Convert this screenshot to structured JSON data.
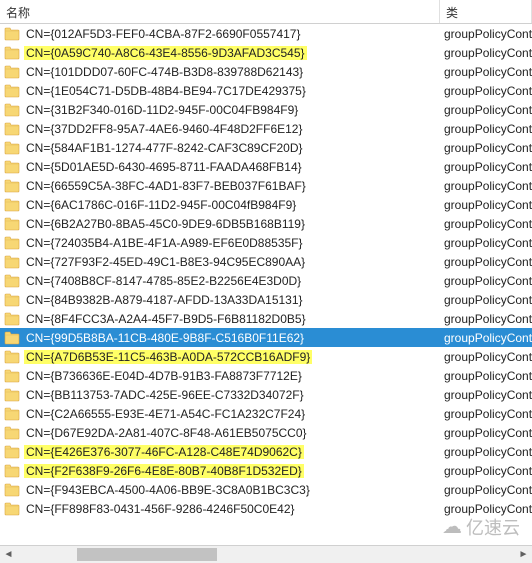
{
  "columns": {
    "name": "名称",
    "type": "类"
  },
  "type_label": "groupPolicyContaine",
  "rows": [
    {
      "name": "CN={012AF5D3-FEF0-4CBA-87F2-6690F0557417}",
      "hl": false,
      "sel": false
    },
    {
      "name": "CN={0A59C740-A8C6-43E4-8556-9D3AFAD3C545}",
      "hl": true,
      "sel": false
    },
    {
      "name": "CN={101DDD07-60FC-474B-B3D8-839788D62143}",
      "hl": false,
      "sel": false
    },
    {
      "name": "CN={1E054C71-D5DB-48B4-BE94-7C17DE429375}",
      "hl": false,
      "sel": false
    },
    {
      "name": "CN={31B2F340-016D-11D2-945F-00C04FB984F9}",
      "hl": false,
      "sel": false
    },
    {
      "name": "CN={37DD2FF8-95A7-4AE6-9460-4F48D2FF6E12}",
      "hl": false,
      "sel": false
    },
    {
      "name": "CN={584AF1B1-1274-477F-8242-CAF3C89CF20D}",
      "hl": false,
      "sel": false
    },
    {
      "name": "CN={5D01AE5D-6430-4695-8711-FAADA468FB14}",
      "hl": false,
      "sel": false
    },
    {
      "name": "CN={66559C5A-38FC-4AD1-83F7-BEB037F61BAF}",
      "hl": false,
      "sel": false
    },
    {
      "name": "CN={6AC1786C-016F-11D2-945F-00C04fB984F9}",
      "hl": false,
      "sel": false
    },
    {
      "name": "CN={6B2A27B0-8BA5-45C0-9DE9-6DB5B168B119}",
      "hl": false,
      "sel": false
    },
    {
      "name": "CN={724035B4-A1BE-4F1A-A989-EF6E0D88535F}",
      "hl": false,
      "sel": false
    },
    {
      "name": "CN={727F93F2-45ED-49C1-B8E3-94C95EC890AA}",
      "hl": false,
      "sel": false
    },
    {
      "name": "CN={7408B8CF-8147-4785-85E2-B2256E4E3D0D}",
      "hl": false,
      "sel": false
    },
    {
      "name": "CN={84B9382B-A879-4187-AFDD-13A33DA15131}",
      "hl": false,
      "sel": false
    },
    {
      "name": "CN={8F4FCC3A-A2A4-45F7-B9D5-F6B81182D0B5}",
      "hl": false,
      "sel": false
    },
    {
      "name": "CN={99D5B8BA-11CB-480E-9B8F-C516B0F11E62}",
      "hl": true,
      "sel": true
    },
    {
      "name": "CN={A7D6B53E-11C5-463B-A0DA-572CCB16ADF9}",
      "hl": true,
      "sel": false
    },
    {
      "name": "CN={B736636E-E04D-4D7B-91B3-FA8873F7712E}",
      "hl": false,
      "sel": false
    },
    {
      "name": "CN={BB113753-7ADC-425E-96EE-C7332D34072F}",
      "hl": false,
      "sel": false
    },
    {
      "name": "CN={C2A66555-E93E-4E71-A54C-FC1A232C7F24}",
      "hl": false,
      "sel": false
    },
    {
      "name": "CN={D67E92DA-2A81-407C-8F48-A61EB5075CC0}",
      "hl": false,
      "sel": false
    },
    {
      "name": "CN={E426E376-3077-46FC-A128-C48E74D9062C}",
      "hl": true,
      "sel": false
    },
    {
      "name": "CN={F2F638F9-26F6-4E8E-80B7-40B8F1D532ED}",
      "hl": true,
      "sel": false
    },
    {
      "name": "CN={F943EBCA-4500-4A06-BB9E-3C8A0B1BC3C3}",
      "hl": false,
      "sel": false
    },
    {
      "name": "CN={FF898F83-0431-456F-9286-4246F50C0E42}",
      "hl": false,
      "sel": false
    }
  ],
  "watermark": "亿速云"
}
